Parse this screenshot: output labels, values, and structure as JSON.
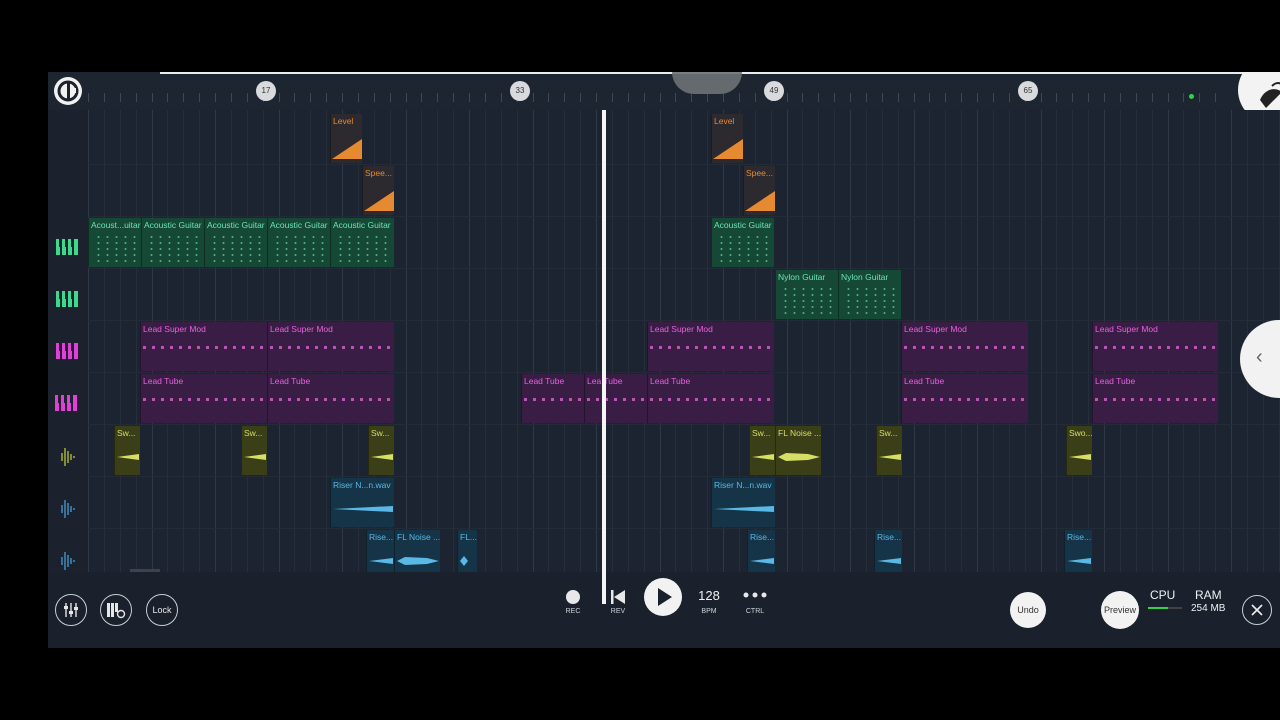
{
  "ruler": {
    "bar_markers": [
      "17",
      "33",
      "49",
      "65"
    ]
  },
  "tracks": [
    {
      "icon": "automation",
      "color": "#e58a30"
    },
    {
      "icon": "automation",
      "color": "#e58a30"
    },
    {
      "icon": "piano-keys-icon",
      "color": "#3fd88f"
    },
    {
      "icon": "piano-keys-icon",
      "color": "#3fd88f"
    },
    {
      "icon": "piano-keys-icon",
      "color": "#e23fd8"
    },
    {
      "icon": "piano-keys-icon",
      "color": "#e23fd8"
    },
    {
      "icon": "waveform-icon",
      "color": "#c9d437"
    },
    {
      "icon": "waveform-icon",
      "color": "#4aa8e0"
    },
    {
      "icon": "waveform-icon",
      "color": "#4aa8e0"
    }
  ],
  "clips": {
    "level": "Level",
    "speed": "Spee...",
    "acoustic_short": "Acoust...uitar",
    "acoustic": "Acoustic Guitar",
    "nylon": "Nylon Guitar",
    "lead_super": "Lead Super Mod",
    "lead_tube": "Lead Tube",
    "lead_tube_partial": "Lea Tube",
    "sweep_sw": "Sw...",
    "sweep_swo": "Swo...",
    "fl_noise": "FL Noise ...",
    "riser_wav": "Riser N...n.wav",
    "riser": "Rise...",
    "fl_noise_2": "FL Noise ...",
    "fl_short": "FL..."
  },
  "transport": {
    "rec_label": "REC",
    "rev_label": "REV",
    "tempo": "128",
    "bpm_label": "BPM",
    "ctrl_label": "CTRL",
    "lock_label": "Lock",
    "undo_label": "Undo",
    "preview_label": "Preview",
    "cpu_label": "CPU",
    "ram_label": "RAM",
    "ram_value": "254 MB"
  },
  "colors": {
    "playhead": "#f5f5f5",
    "cpu_meter": "#31d24b"
  }
}
